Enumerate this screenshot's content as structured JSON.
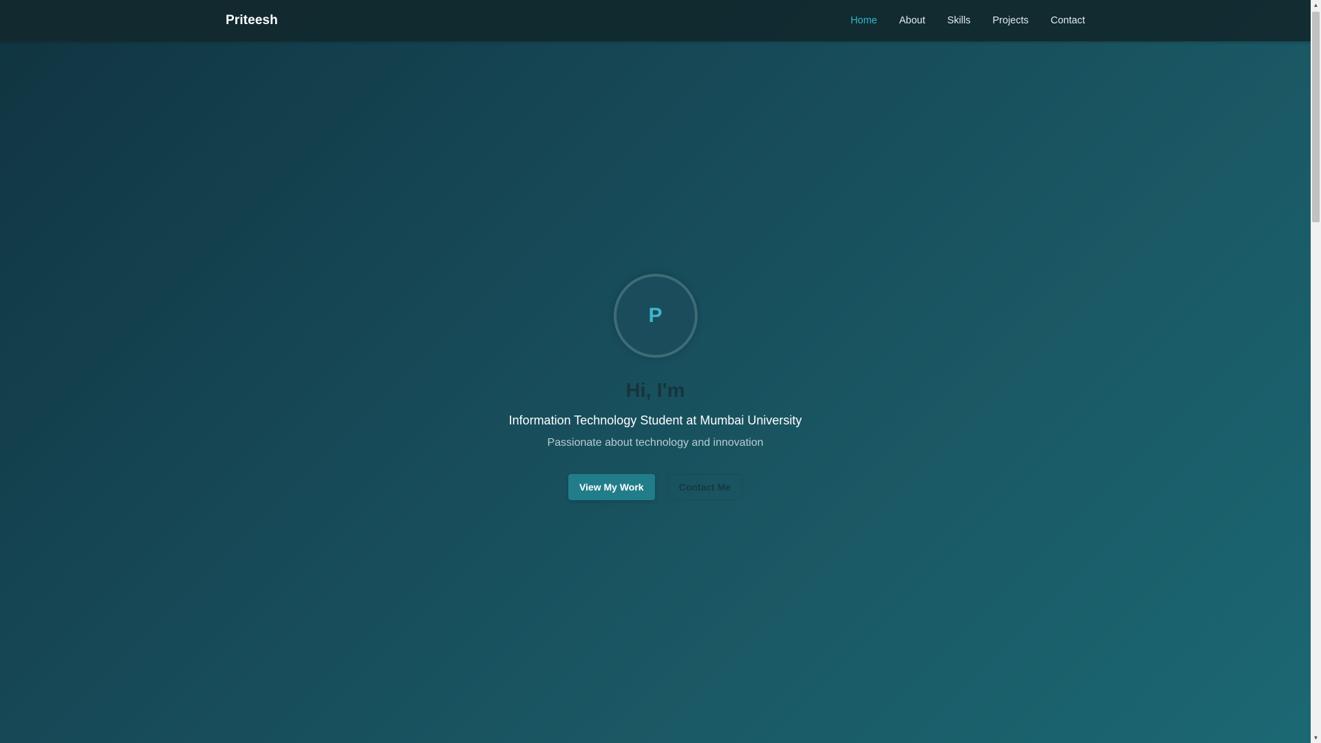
{
  "nav": {
    "brand": "Priteesh",
    "links": [
      {
        "label": "Home",
        "active": true
      },
      {
        "label": "About",
        "active": false
      },
      {
        "label": "Skills",
        "active": false
      },
      {
        "label": "Projects",
        "active": false
      },
      {
        "label": "Contact",
        "active": false
      }
    ]
  },
  "hero": {
    "avatar_letter": "P",
    "greeting": "Hi, I'm",
    "subtitle": "Information Technology Student at Mumbai University",
    "tagline": "Passionate about technology and innovation",
    "primary_button": "View My Work",
    "secondary_button": "Contact Me"
  },
  "scrollbar": {
    "up_arrow": "▲",
    "down_arrow": "▼"
  },
  "colors": {
    "accent": "#34b6c8",
    "primary_button": "#227d8a",
    "navbar": "#11282e"
  }
}
